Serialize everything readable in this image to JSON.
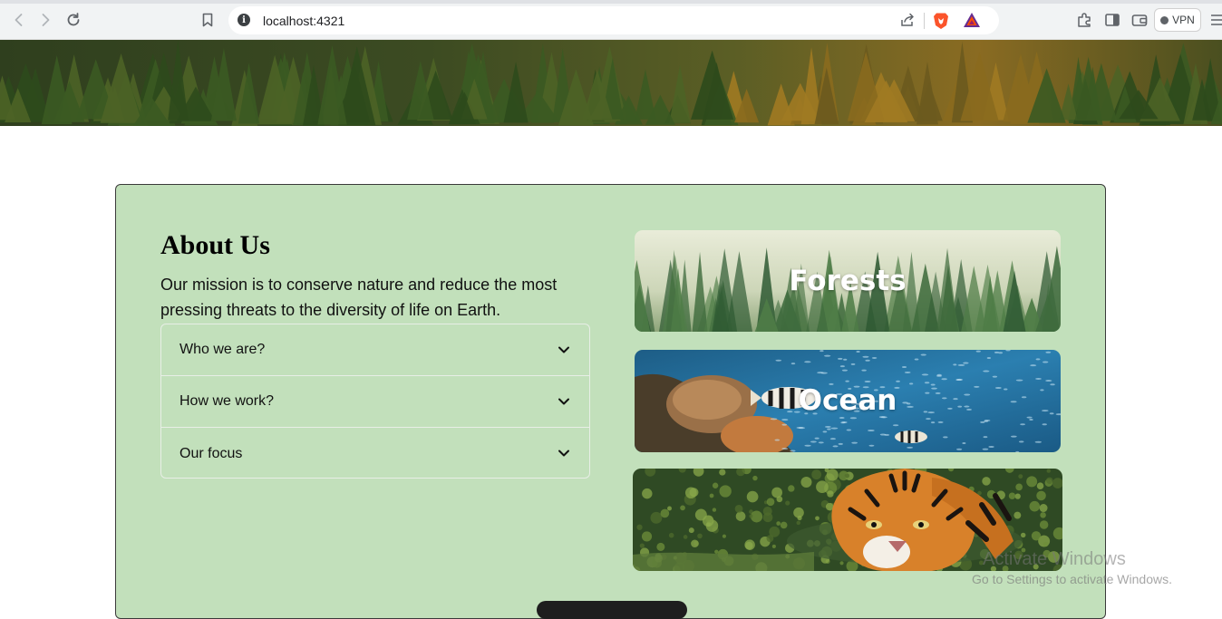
{
  "browser": {
    "url": "localhost:4321",
    "vpn_label": "VPN"
  },
  "about": {
    "title": "About Us",
    "description": "Our mission is to conserve nature and reduce the most pressing threats to the diversity of life on Earth.",
    "accordion": [
      {
        "label": "Who we are?"
      },
      {
        "label": "How we work?"
      },
      {
        "label": "Our focus"
      }
    ]
  },
  "tiles": [
    {
      "label": "Forests"
    },
    {
      "label": "Ocean"
    },
    {
      "label": ""
    }
  ],
  "watermark": {
    "line1": "Activate Windows",
    "line2": "Go to Settings to activate Windows."
  },
  "colors": {
    "card_bg": "#c2e0bb",
    "chrome_bg": "#f1f3f4"
  }
}
